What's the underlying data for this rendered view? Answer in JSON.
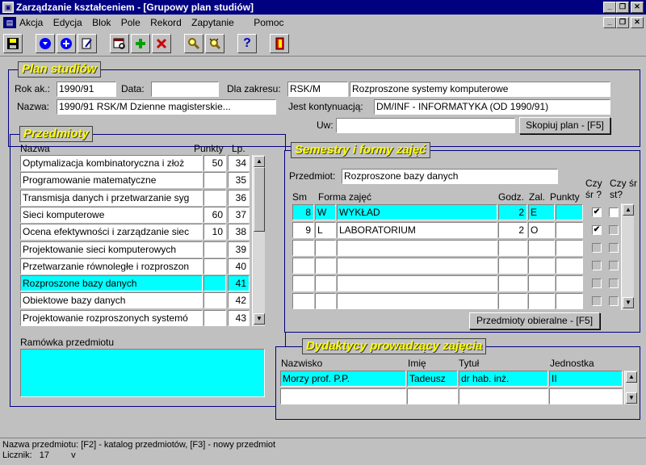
{
  "window": {
    "title": "Zarządzanie kształceniem - [Grupowy plan studiów]"
  },
  "menu": [
    "Akcja",
    "Edycja",
    "Blok",
    "Pole",
    "Rekord",
    "Zapytanie",
    "Pomoc"
  ],
  "plan": {
    "title": "Plan studiów",
    "rok_label": "Rok ak.:",
    "rok_value": "1990/91",
    "data_label": "Data:",
    "data_value": "",
    "zakres_label": "Dla zakresu:",
    "zakres_code": "RSK/M",
    "zakres_name": "Rozproszone systemy komputerowe",
    "nazwa_label": "Nazwa:",
    "nazwa_value": "1990/91 RSK/M Dzienne magisterskie...",
    "kontynuacja_label": "Jest kontynuacją:",
    "kontynuacja_value": "DM/INF - INFORMATYKA (OD 1990/91)",
    "uw_label": "Uw:",
    "uw_value": "",
    "copy_button": "Skopiuj plan - [F5]"
  },
  "przedmioty": {
    "title": "Przedmioty",
    "col_nazwa": "Nazwa",
    "col_punkty": "Punkty",
    "col_lp": "Lp.",
    "rows": [
      {
        "nazwa": "Optymalizacja kombinatoryczna i złoż",
        "punkty": "50",
        "lp": "34"
      },
      {
        "nazwa": "Programowanie matematyczne",
        "punkty": "",
        "lp": "35"
      },
      {
        "nazwa": "Transmisja danych i przetwarzanie syg",
        "punkty": "",
        "lp": "36"
      },
      {
        "nazwa": "Sieci komputerowe",
        "punkty": "60",
        "lp": "37"
      },
      {
        "nazwa": "Ocena efektywności i zarządzanie siec",
        "punkty": "10",
        "lp": "38"
      },
      {
        "nazwa": "Projektowanie sieci komputerowych",
        "punkty": "",
        "lp": "39"
      },
      {
        "nazwa": "Przetwarzanie równoległe i rozproszon",
        "punkty": "",
        "lp": "40"
      },
      {
        "nazwa": "Rozproszone bazy danych",
        "punkty": "",
        "lp": "41"
      },
      {
        "nazwa": "Obiektowe bazy danych",
        "punkty": "",
        "lp": "42"
      },
      {
        "nazwa": "Projektowanie rozproszonych systemó",
        "punkty": "",
        "lp": "43"
      }
    ],
    "ramowka_label": "Ramówka przedmiotu"
  },
  "semestry": {
    "title": "Semestry i formy zajęć",
    "przedmiot_label": "Przedmiot:",
    "przedmiot_value": "Rozproszone bazy danych",
    "col_sm": "Sm",
    "col_forma": "Forma zajęć",
    "col_godz": "Godz.",
    "col_zal": "Zal.",
    "col_punkty": "Punkty",
    "col_czy_sr": "Czy śr ?",
    "col_czy_sr_st": "Czy śr st?",
    "rows": [
      {
        "sm": "8",
        "f": "W",
        "forma": "WYKŁAD",
        "godz": "2",
        "zal": "E",
        "punkty": "",
        "sr": true,
        "srst": false
      },
      {
        "sm": "9",
        "f": "L",
        "forma": "LABORATORIUM",
        "godz": "2",
        "zal": "O",
        "punkty": "",
        "sr": true,
        "srst": false
      },
      {
        "sm": "",
        "f": "",
        "forma": "",
        "godz": "",
        "zal": "",
        "punkty": "",
        "sr": false,
        "srst": false
      },
      {
        "sm": "",
        "f": "",
        "forma": "",
        "godz": "",
        "zal": "",
        "punkty": "",
        "sr": false,
        "srst": false
      },
      {
        "sm": "",
        "f": "",
        "forma": "",
        "godz": "",
        "zal": "",
        "punkty": "",
        "sr": false,
        "srst": false
      },
      {
        "sm": "",
        "f": "",
        "forma": "",
        "godz": "",
        "zal": "",
        "punkty": "",
        "sr": false,
        "srst": false
      }
    ],
    "obieralne_button": "Przedmioty obieralne - [F5]"
  },
  "dydaktycy": {
    "title": "Dydaktycy prowadzący zajęcia",
    "col_nazwisko": "Nazwisko",
    "col_imie": "Imię",
    "col_tytul": "Tytuł",
    "col_jednostka": "Jednostka",
    "rows": [
      {
        "nazwisko": "Morzy prof. P.P.",
        "imie": "Tadeusz",
        "tytul": "dr hab. inż.",
        "jednostka": "II"
      },
      {
        "nazwisko": "",
        "imie": "",
        "tytul": "",
        "jednostka": ""
      }
    ]
  },
  "status": {
    "line1": "Nazwa przedmiotu: [F2] - katalog przedmiotów, [F3] - nowy przedmiot",
    "line2_label": "Licznik:",
    "line2_count": "17",
    "line2_extra": "v"
  },
  "colors": {
    "title_bg": "#000080",
    "group_title": "#ffff00",
    "selection": "#00ffff"
  }
}
